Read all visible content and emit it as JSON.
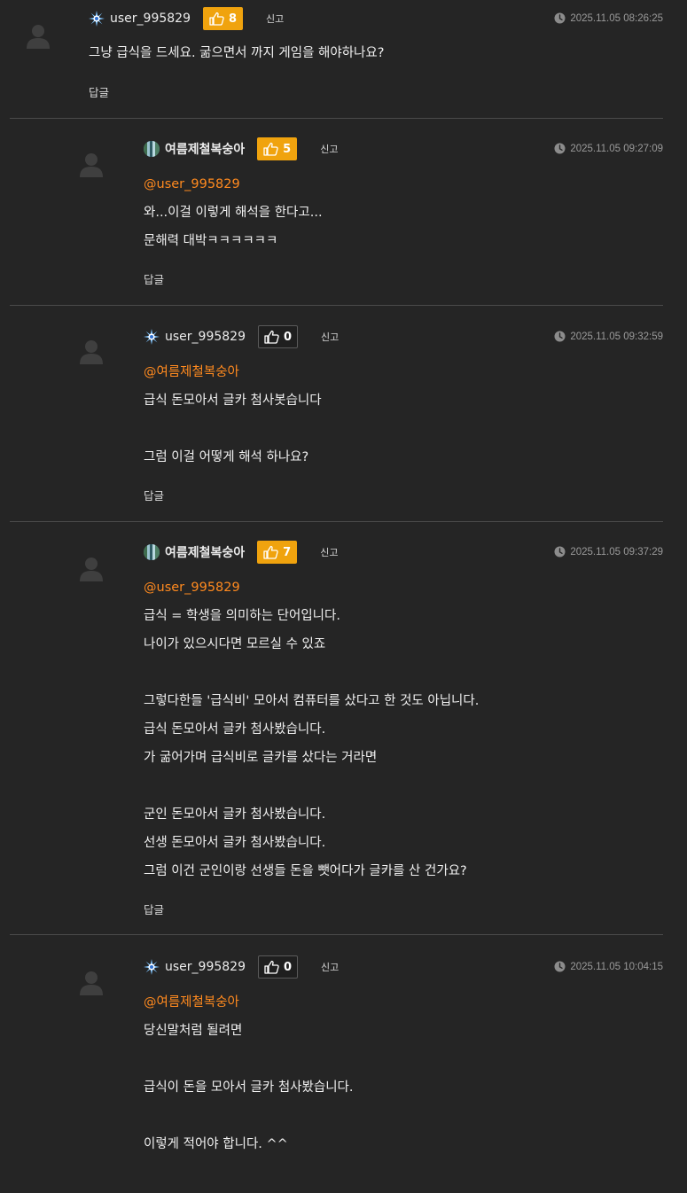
{
  "comments": [
    {
      "username": "user_995829",
      "user_icon": "burst-icon",
      "likes": "8",
      "like_active": true,
      "report_label": "신고",
      "timestamp": "2025.11.05 08:26:25",
      "mention": "",
      "lines": [
        "그냥 급식을 드세요. 굶으면서 까지 게임을 해야하나요?"
      ],
      "reply_label": "답글"
    },
    {
      "username": "여름제철복숭아",
      "user_icon": "nature-icon",
      "likes": "5",
      "like_active": true,
      "report_label": "신고",
      "timestamp": "2025.11.05 09:27:09",
      "mention": "@user_995829",
      "lines": [
        "와...이걸 이렇게 해석을 한다고...",
        "문해력 대박ㅋㅋㅋㅋㅋㅋ"
      ],
      "reply_label": "답글"
    },
    {
      "username": "user_995829",
      "user_icon": "burst-icon",
      "likes": "0",
      "like_active": false,
      "report_label": "신고",
      "timestamp": "2025.11.05 09:32:59",
      "mention": "@여름제철복숭아",
      "lines": [
        "급식 돈모아서 글카 첨사봇습니다",
        "",
        "그럼 이걸 어떻게 해석 하나요?"
      ],
      "reply_label": "답글"
    },
    {
      "username": "여름제철복숭아",
      "user_icon": "nature-icon",
      "likes": "7",
      "like_active": true,
      "report_label": "신고",
      "timestamp": "2025.11.05 09:37:29",
      "mention": "@user_995829",
      "lines": [
        "급식 = 학생을 의미하는 단어입니다.",
        "나이가 있으시다면 모르실 수 있죠",
        "",
        "그렇다한들 '급식비' 모아서 컴퓨터를 샀다고 한 것도 아닙니다.",
        "급식 돈모아서 글카 첨사봤습니다.",
        "가 굶어가며 급식비로 글카를 샀다는 거라면",
        "",
        "군인 돈모아서 글카 첨사봤습니다.",
        "선생 돈모아서 글카 첨사봤습니다.",
        "그럼 이건 군인이랑 선생들 돈을 뺏어다가 글카를 산 건가요?"
      ],
      "reply_label": "답글"
    },
    {
      "username": "user_995829",
      "user_icon": "burst-icon",
      "likes": "0",
      "like_active": false,
      "report_label": "신고",
      "timestamp": "2025.11.05 10:04:15",
      "mention": "@여름제철복숭아",
      "lines": [
        "당신말처럼 될려면",
        "",
        "급식이 돈을 모아서 글카 첨사봤습니다.",
        "",
        "이렇게 적어야 합니다. ^^"
      ],
      "reply_label": ""
    }
  ],
  "colors": {
    "background": "#252525",
    "accent_like": "#f0a30e",
    "mention": "#ff8a1f",
    "divider": "#4b4b4b"
  }
}
